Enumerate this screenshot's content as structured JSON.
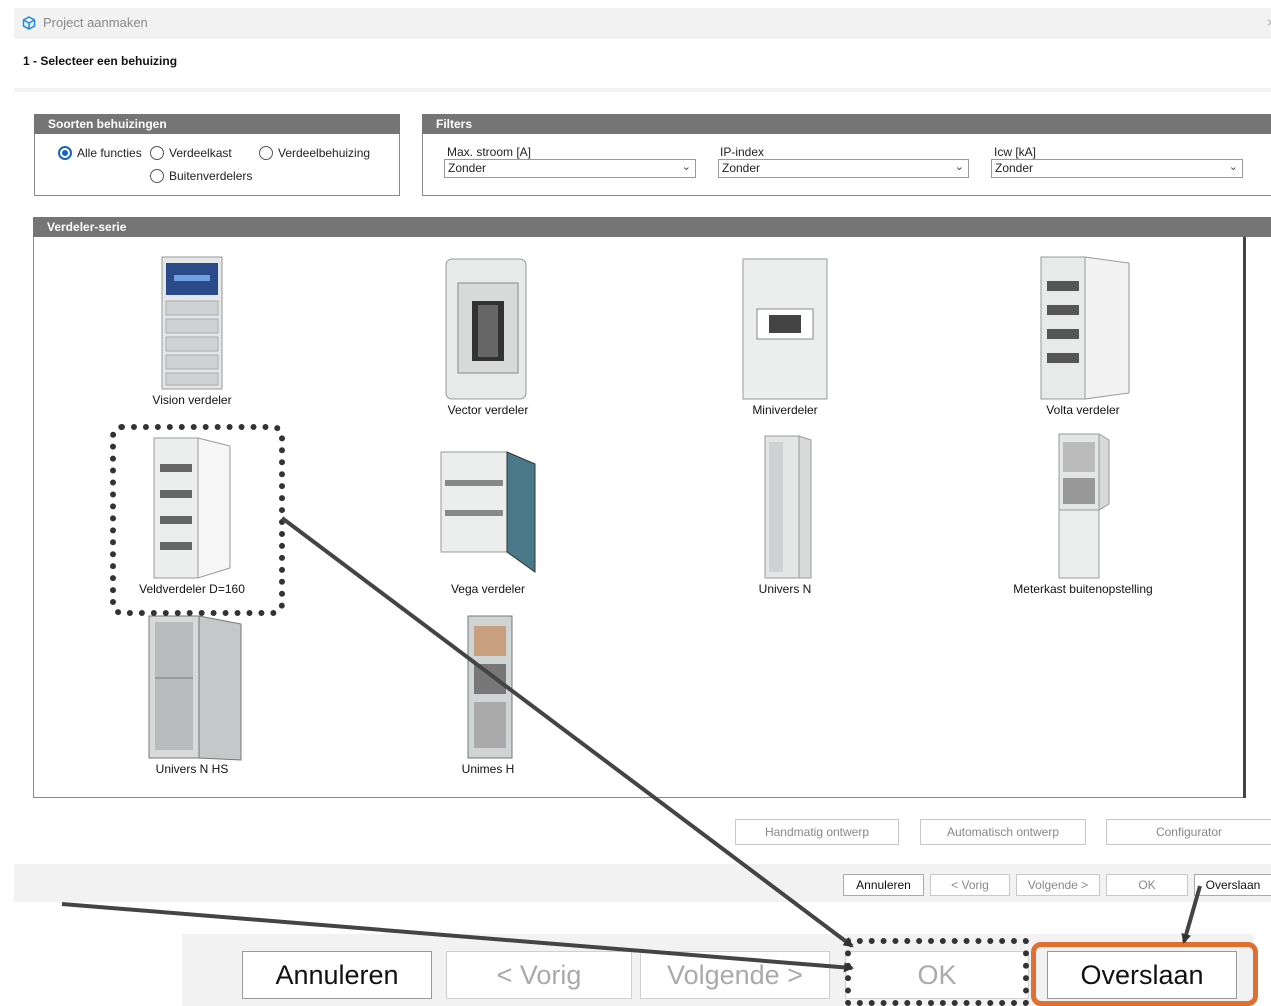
{
  "window": {
    "title": "Project aanmaken",
    "close_glyph": "×",
    "icon": "cube-icon"
  },
  "step_title": "1 - Selecteer een behuizing",
  "types_panel": {
    "header": "Soorten behuizingen",
    "options": [
      "Alle functies",
      "Verdeelkast",
      "Verdeelbehuizing",
      "Buitenverdelers"
    ],
    "selected": "Alle functies"
  },
  "filters_panel": {
    "header": "Filters",
    "fields": [
      {
        "label": "Max. stroom [A]",
        "value": "Zonder"
      },
      {
        "label": "IP-index",
        "value": "Zonder"
      },
      {
        "label": "Icw [kA]",
        "value": "Zonder"
      }
    ]
  },
  "series_panel": {
    "header": "Verdeler-serie",
    "items": [
      "Vision verdeler",
      "Vector verdeler",
      "Miniverdeler",
      "Volta verdeler",
      "Veldverdeler D=160",
      "Vega verdeler",
      "Univers N",
      "Meterkast buitenopstelling",
      "Univers N HS",
      "Unimes H"
    ]
  },
  "design_buttons": [
    "Handmatig ontwerp",
    "Automatisch ontwerp",
    "Configurator"
  ],
  "footer_buttons": {
    "cancel": "Annuleren",
    "prev": "< Vorig",
    "next": "Volgende >",
    "ok": "OK",
    "skip": "Overslaan"
  },
  "zoomed_footer": {
    "cancel": "Annuleren",
    "prev": "< Vorig",
    "next": "Volgende >",
    "ok": "OK",
    "skip": "Overslaan"
  },
  "colors": {
    "panel_header": "#757575",
    "radio_selected": "#1565c0",
    "highlight_orange": "#e07030",
    "highlight_dotted": "#333333"
  }
}
